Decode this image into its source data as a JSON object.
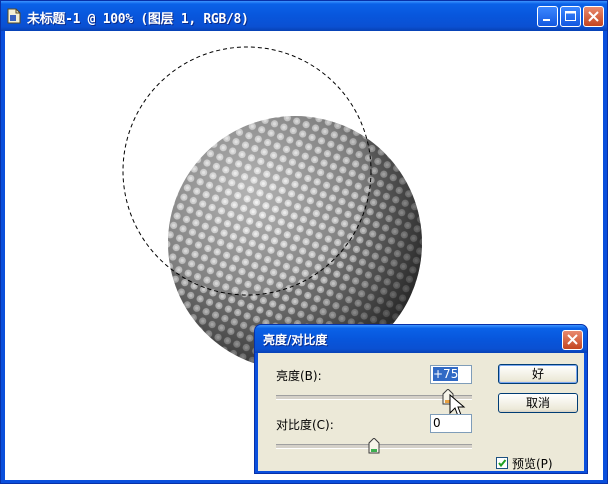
{
  "window": {
    "title": "未标题-1 @ 100% (图层 1, RGB/8)",
    "icon": "photoshop-document-icon"
  },
  "dialog": {
    "title": "亮度/对比度",
    "brightness_label": "亮度(B):",
    "brightness_value": "+75",
    "brightness_level": 75,
    "contrast_label": "对比度(C):",
    "contrast_value": "0",
    "contrast_level": 0,
    "ok_label": "好",
    "cancel_label": "取消",
    "preview_label": "预览(P)",
    "preview_checked": true
  },
  "colors": {
    "titlebar": "#0a50d2",
    "dialog_face": "#ece9d8",
    "close_button": "#c4451f",
    "selection": "#316ac5"
  }
}
